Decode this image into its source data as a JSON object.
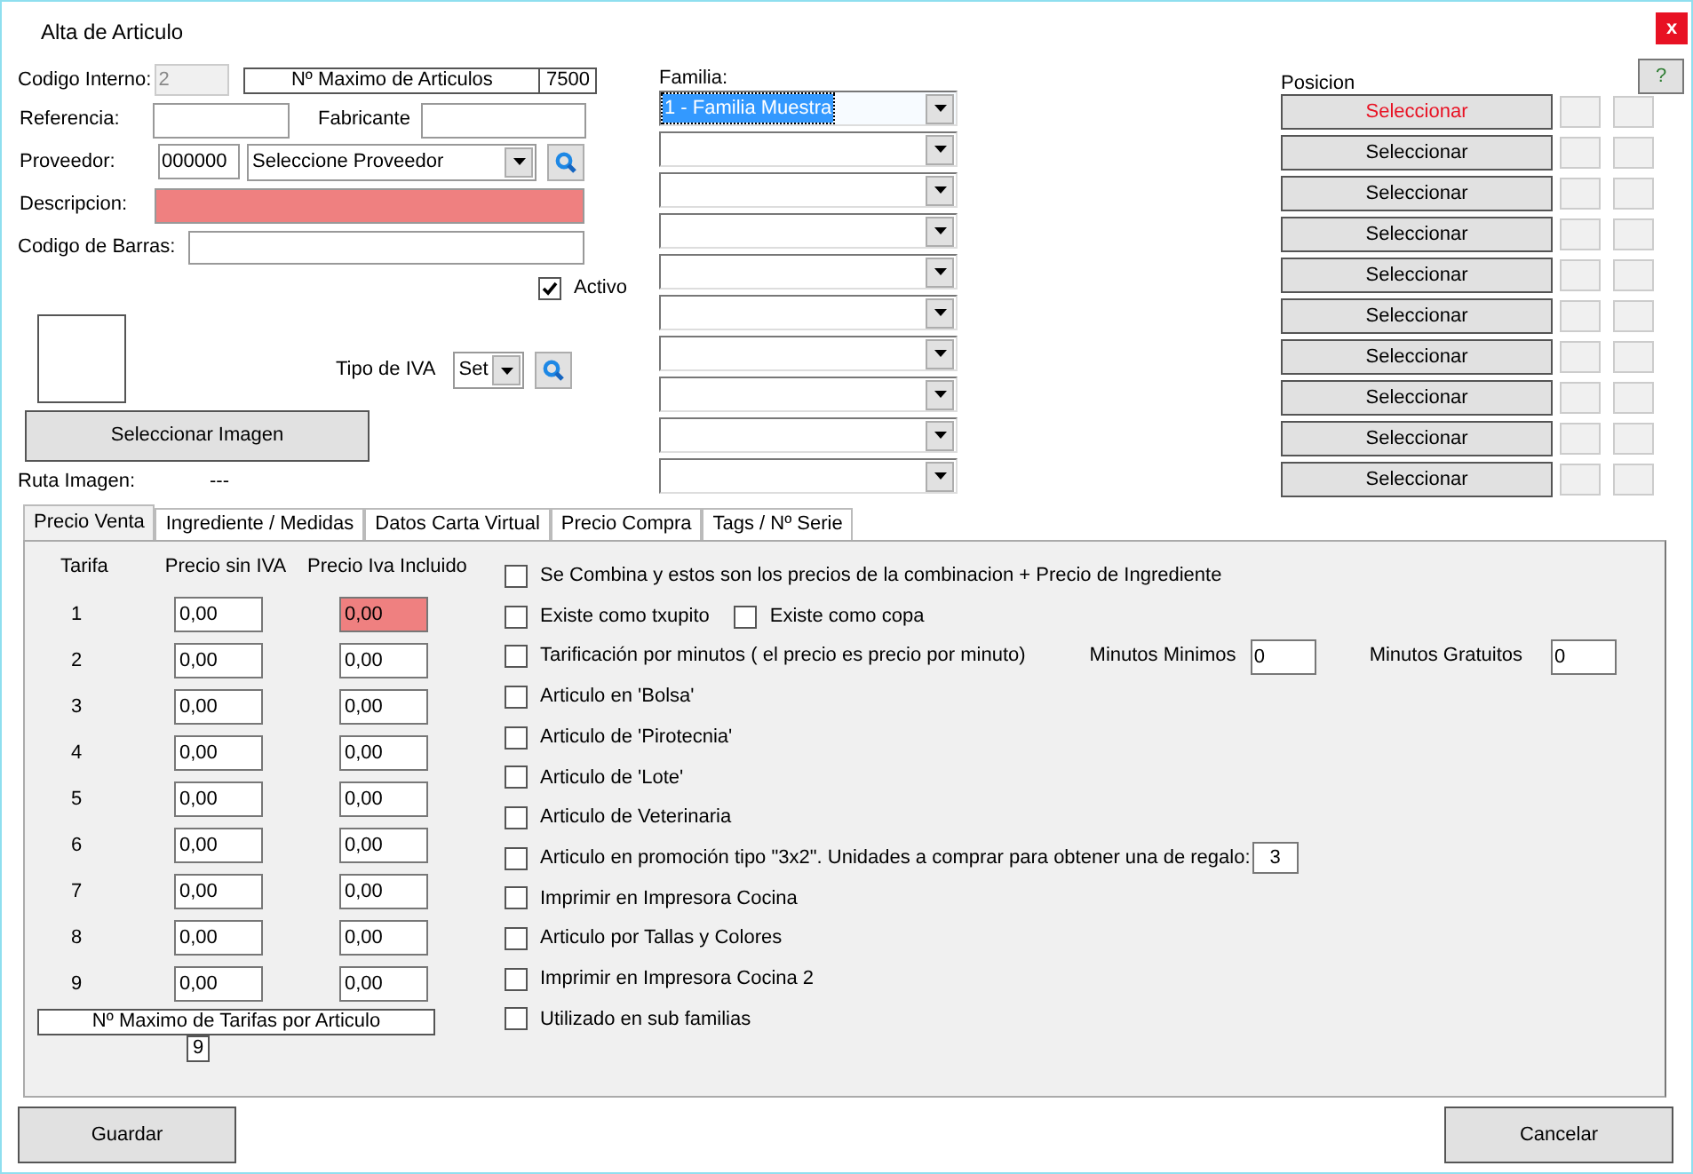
{
  "window": {
    "title": "Alta de Articulo",
    "close": "x"
  },
  "help_button": "?",
  "general": {
    "codigo_interno": {
      "label": "Codigo Interno:",
      "value": "2"
    },
    "max_articulos": {
      "label": "Nº Maximo de Articulos",
      "value": "7500"
    },
    "referencia": {
      "label": "Referencia:"
    },
    "fabricante": {
      "label": "Fabricante"
    },
    "proveedor": {
      "label": "Proveedor:",
      "code": "000000",
      "value": "Seleccione Proveedor"
    },
    "descripcion": {
      "label": "Descripcion:",
      "error": true
    },
    "codigo_barras": {
      "label": "Codigo de Barras:"
    },
    "activo": {
      "label": "Activo",
      "checked": true
    },
    "tipo_iva": {
      "label": "Tipo de IVA",
      "value": "Set"
    },
    "imagen_button": "Seleccionar Imagen",
    "ruta_imagen": {
      "label": "Ruta Imagen:",
      "value": "---"
    }
  },
  "familia": {
    "label": "Familia:",
    "combos": [
      {
        "value": "1 - Familia Muestra",
        "selected": true
      },
      {
        "selected": false
      },
      {
        "selected": false
      },
      {
        "selected": false
      },
      {
        "selected": false
      },
      {
        "selected": false
      },
      {
        "selected": false
      },
      {
        "selected": false
      },
      {
        "selected": false
      },
      {
        "selected": false
      }
    ]
  },
  "posicion": {
    "label": "Posicion",
    "rows": [
      {
        "button": "Seleccionar",
        "color": "#e81123"
      },
      {
        "button": "Seleccionar",
        "color": "#000000"
      },
      {
        "button": "Seleccionar",
        "color": "#000000"
      },
      {
        "button": "Seleccionar",
        "color": "#000000"
      },
      {
        "button": "Seleccionar",
        "color": "#000000"
      },
      {
        "button": "Seleccionar",
        "color": "#000000"
      },
      {
        "button": "Seleccionar",
        "color": "#000000"
      },
      {
        "button": "Seleccionar",
        "color": "#000000"
      },
      {
        "button": "Seleccionar",
        "color": "#000000"
      },
      {
        "button": "Seleccionar",
        "color": "#000000"
      }
    ]
  },
  "tabs": [
    {
      "label": "Precio Venta",
      "selected": true
    },
    {
      "label": "Ingrediente / Medidas",
      "selected": false
    },
    {
      "label": "Datos Carta Virtual",
      "selected": false
    },
    {
      "label": "Precio Compra",
      "selected": false
    },
    {
      "label": "Tags / Nº Serie",
      "selected": false
    }
  ],
  "prices": {
    "columns": [
      "Tarifa",
      "Precio sin IVA",
      "Precio Iva Incluido"
    ],
    "rows": [
      {
        "tarifa": "1",
        "sin_iva": "0,00",
        "con_iva": "0,00",
        "error": true
      },
      {
        "tarifa": "2",
        "sin_iva": "0,00",
        "con_iva": "0,00",
        "error": false
      },
      {
        "tarifa": "3",
        "sin_iva": "0,00",
        "con_iva": "0,00",
        "error": false
      },
      {
        "tarifa": "4",
        "sin_iva": "0,00",
        "con_iva": "0,00",
        "error": false
      },
      {
        "tarifa": "5",
        "sin_iva": "0,00",
        "con_iva": "0,00",
        "error": false
      },
      {
        "tarifa": "6",
        "sin_iva": "0,00",
        "con_iva": "0,00",
        "error": false
      },
      {
        "tarifa": "7",
        "sin_iva": "0,00",
        "con_iva": "0,00",
        "error": false
      },
      {
        "tarifa": "8",
        "sin_iva": "0,00",
        "con_iva": "0,00",
        "error": false
      },
      {
        "tarifa": "9",
        "sin_iva": "0,00",
        "con_iva": "0,00",
        "error": false
      }
    ],
    "max_tarifas": {
      "label": "Nº Maximo de Tarifas por Articulo",
      "value": "9"
    }
  },
  "options": [
    {
      "kind": "plain",
      "label": "Se Combina y estos son los precios de la combinacion + Precio de Ingrediente",
      "checked": false
    },
    {
      "kind": "pair",
      "label": "Existe como txupito",
      "checked": false,
      "second": {
        "label": "Existe como copa",
        "checked": false
      }
    },
    {
      "kind": "minutes",
      "label": "Tarificación por minutos ( el precio es precio por minuto)",
      "checked": false,
      "fields": [
        {
          "label": "Minutos Minimos",
          "value": "0"
        },
        {
          "label": "Minutos Gratuitos",
          "value": "0"
        }
      ]
    },
    {
      "kind": "plain",
      "label": "Articulo en 'Bolsa'",
      "checked": false
    },
    {
      "kind": "plain",
      "label": "Articulo de 'Pirotecnia'",
      "checked": false
    },
    {
      "kind": "plain",
      "label": "Articulo de 'Lote'",
      "checked": false
    },
    {
      "kind": "plain",
      "label": "Articulo de Veterinaria",
      "checked": false
    },
    {
      "kind": "promo",
      "label": "Articulo en promoción tipo \"3x2\". Unidades a comprar para obtener una de regalo:",
      "checked": false,
      "value": "3"
    },
    {
      "kind": "plain",
      "label": "Imprimir en Impresora Cocina",
      "checked": false
    },
    {
      "kind": "plain",
      "label": "Articulo por Tallas y Colores",
      "checked": false
    },
    {
      "kind": "plain",
      "label": "Imprimir en Impresora Cocina 2",
      "checked": false
    },
    {
      "kind": "plain",
      "label": "Utilizado en  sub familias",
      "checked": false
    }
  ],
  "buttons": {
    "save": "Guardar",
    "cancel": "Cancelar"
  }
}
